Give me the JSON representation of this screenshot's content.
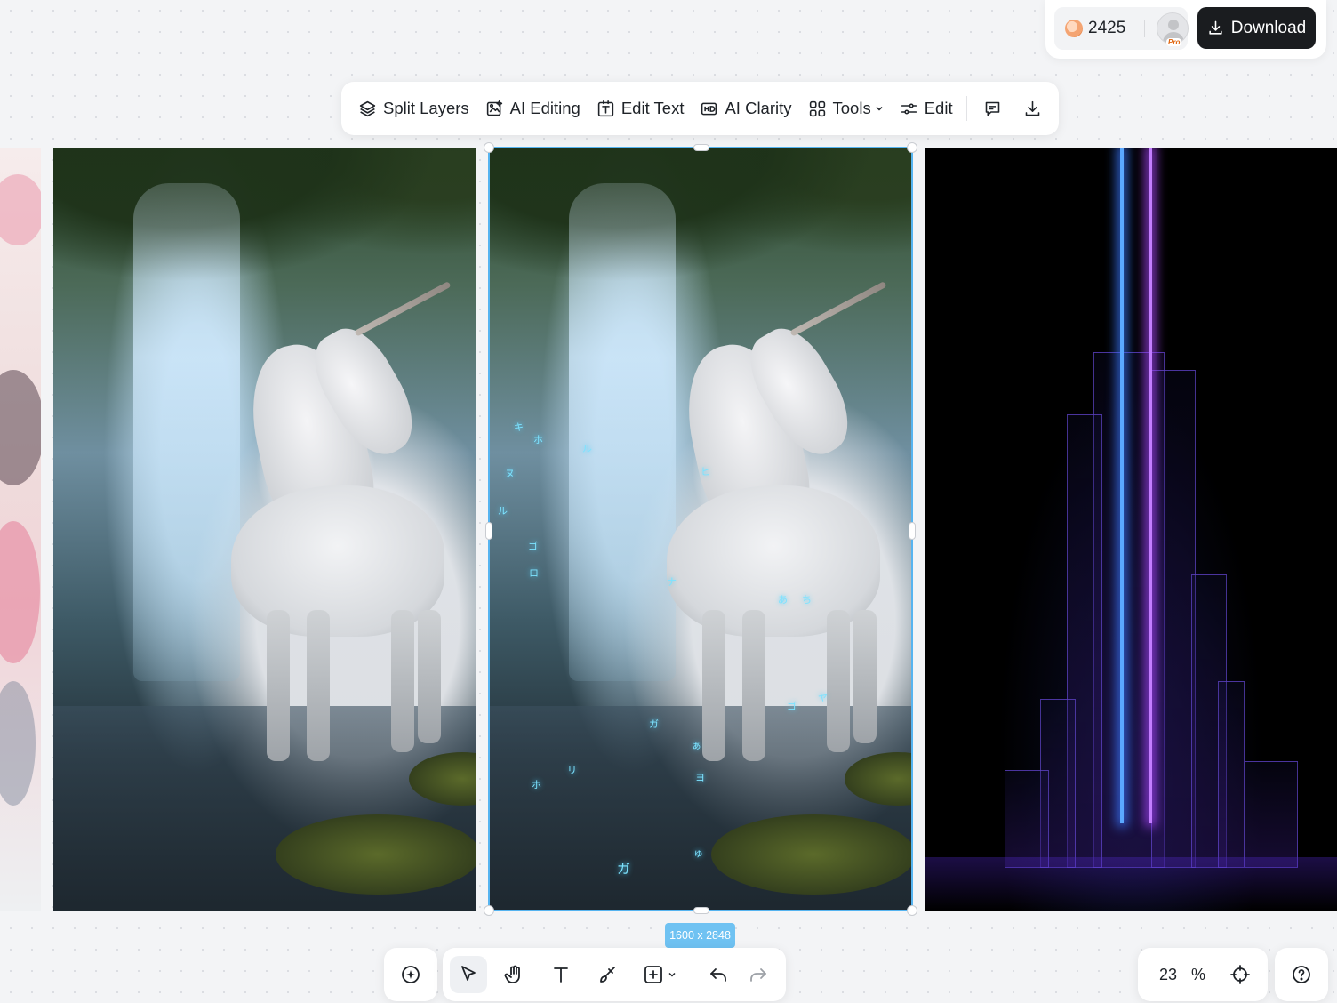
{
  "account": {
    "credits": "2425",
    "plan_badge": "Pro",
    "download_label": "Download"
  },
  "toolbar": {
    "items": [
      {
        "label": "Split Layers",
        "icon": "layers-icon"
      },
      {
        "label": "AI Editing",
        "icon": "ai-edit-icon"
      },
      {
        "label": "Edit Text",
        "icon": "text-box-icon"
      },
      {
        "label": "AI Clarity",
        "icon": "hd-icon"
      },
      {
        "label": "Tools",
        "icon": "grid-icon"
      },
      {
        "label": "Edit",
        "icon": "sliders-icon"
      }
    ],
    "icon_buttons": [
      "comment-icon",
      "download-icon"
    ]
  },
  "canvas": {
    "selected_image_size": "1600 x 2848",
    "images": [
      "cherry-blossom",
      "unicorn-original",
      "unicorn-edited",
      "neon-city"
    ]
  },
  "bottom_toolbar": {
    "tools": [
      "add-icon",
      "select-cursor-icon",
      "hand-icon",
      "text-icon",
      "brush-icon",
      "insert-icon",
      "undo-icon",
      "redo-icon"
    ],
    "active_tool": "select-cursor-icon",
    "zoom_value": "23",
    "zoom_unit": "%"
  },
  "colors": {
    "selection": "#56b4f0",
    "size_tag": "#6fc2f2",
    "download_button": "#1a1c1f"
  }
}
